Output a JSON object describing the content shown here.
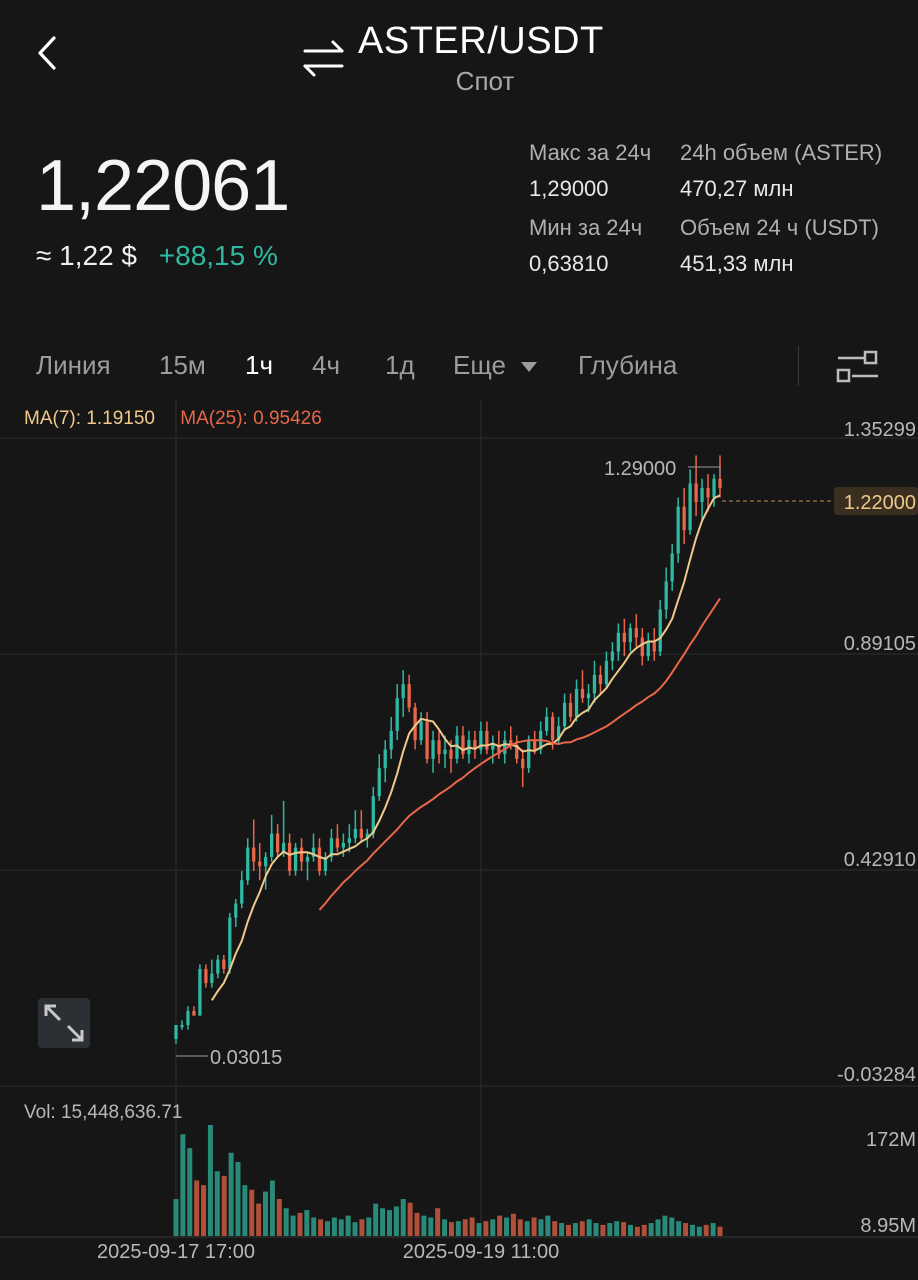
{
  "header": {
    "pair": "ASTER/USDT",
    "market": "Спот"
  },
  "price": {
    "last": "1,22061",
    "approx": "≈ 1,22 $",
    "change": "+88,15 %"
  },
  "stats": {
    "high_label": "Макс за 24ч",
    "high_value": "1,29000",
    "low_label": "Мин за 24ч",
    "low_value": "0,63810",
    "vol_base_label": "24h объем (ASTER)",
    "vol_base_value": "470,27 млн",
    "vol_quote_label": "Объем 24 ч (USDT)",
    "vol_quote_value": "451,33 млн"
  },
  "tabs": {
    "line": "Линия",
    "m15": "15м",
    "h1": "1ч",
    "h4": "4ч",
    "d1": "1д",
    "more": "Еще",
    "depth": "Глубина"
  },
  "indicators": {
    "ma7": "MA(7): 1.19150",
    "ma25": "MA(25): 0.95426"
  },
  "chart_data": {
    "type": "candlestick",
    "y_ticks": [
      "1.35299",
      "0.89105",
      "0.42910",
      "-0.03284"
    ],
    "ylim": [
      -0.03284,
      1.35299
    ],
    "x_ticks": [
      "2025-09-17 17:00",
      "2025-09-19 11:00"
    ],
    "high_label": "1.29000",
    "low_label": "0.03015",
    "current_label": "1.22000",
    "volume_label": "Vol: 15,448,636.71",
    "volume_ticks": [
      "172M",
      "8.95M"
    ],
    "colors": {
      "up": "#2fb8a2",
      "down": "#e8674a",
      "ma7": "#f0c98a",
      "ma25": "#e8674a"
    },
    "candles": [
      [
        0.04,
        0.07,
        0.03,
        0.07
      ],
      [
        0.07,
        0.08,
        0.06,
        0.07
      ],
      [
        0.07,
        0.11,
        0.06,
        0.1
      ],
      [
        0.1,
        0.11,
        0.09,
        0.09
      ],
      [
        0.09,
        0.2,
        0.09,
        0.19
      ],
      [
        0.19,
        0.2,
        0.15,
        0.16
      ],
      [
        0.16,
        0.21,
        0.15,
        0.18
      ],
      [
        0.18,
        0.22,
        0.17,
        0.21
      ],
      [
        0.21,
        0.22,
        0.18,
        0.19
      ],
      [
        0.19,
        0.31,
        0.18,
        0.3
      ],
      [
        0.3,
        0.34,
        0.28,
        0.33
      ],
      [
        0.33,
        0.4,
        0.32,
        0.38
      ],
      [
        0.38,
        0.47,
        0.37,
        0.45
      ],
      [
        0.45,
        0.51,
        0.4,
        0.42
      ],
      [
        0.42,
        0.46,
        0.38,
        0.41
      ],
      [
        0.41,
        0.44,
        0.36,
        0.43
      ],
      [
        0.43,
        0.52,
        0.42,
        0.48
      ],
      [
        0.48,
        0.5,
        0.43,
        0.44
      ],
      [
        0.44,
        0.55,
        0.43,
        0.46
      ],
      [
        0.46,
        0.48,
        0.39,
        0.4
      ],
      [
        0.4,
        0.46,
        0.39,
        0.45
      ],
      [
        0.45,
        0.47,
        0.4,
        0.42
      ],
      [
        0.42,
        0.44,
        0.38,
        0.43
      ],
      [
        0.43,
        0.48,
        0.42,
        0.45
      ],
      [
        0.45,
        0.47,
        0.39,
        0.4
      ],
      [
        0.4,
        0.44,
        0.39,
        0.43
      ],
      [
        0.43,
        0.49,
        0.42,
        0.47
      ],
      [
        0.47,
        0.5,
        0.44,
        0.45
      ],
      [
        0.45,
        0.48,
        0.43,
        0.46
      ],
      [
        0.46,
        0.5,
        0.44,
        0.47
      ],
      [
        0.47,
        0.53,
        0.46,
        0.49
      ],
      [
        0.49,
        0.53,
        0.46,
        0.47
      ],
      [
        0.47,
        0.49,
        0.45,
        0.48
      ],
      [
        0.48,
        0.58,
        0.47,
        0.56
      ],
      [
        0.56,
        0.65,
        0.55,
        0.62
      ],
      [
        0.62,
        0.68,
        0.59,
        0.66
      ],
      [
        0.66,
        0.73,
        0.64,
        0.7
      ],
      [
        0.7,
        0.8,
        0.68,
        0.77
      ],
      [
        0.77,
        0.83,
        0.73,
        0.8
      ],
      [
        0.8,
        0.82,
        0.74,
        0.75
      ],
      [
        0.75,
        0.76,
        0.66,
        0.68
      ],
      [
        0.68,
        0.74,
        0.67,
        0.72
      ],
      [
        0.72,
        0.74,
        0.63,
        0.64
      ],
      [
        0.64,
        0.7,
        0.61,
        0.68
      ],
      [
        0.68,
        0.7,
        0.63,
        0.65
      ],
      [
        0.65,
        0.69,
        0.62,
        0.66
      ],
      [
        0.66,
        0.68,
        0.61,
        0.64
      ],
      [
        0.64,
        0.71,
        0.63,
        0.69
      ],
      [
        0.69,
        0.71,
        0.64,
        0.65
      ],
      [
        0.65,
        0.7,
        0.63,
        0.68
      ],
      [
        0.68,
        0.7,
        0.64,
        0.66
      ],
      [
        0.66,
        0.72,
        0.65,
        0.7
      ],
      [
        0.7,
        0.72,
        0.65,
        0.66
      ],
      [
        0.66,
        0.69,
        0.63,
        0.67
      ],
      [
        0.67,
        0.7,
        0.64,
        0.65
      ],
      [
        0.65,
        0.7,
        0.63,
        0.68
      ],
      [
        0.68,
        0.71,
        0.66,
        0.67
      ],
      [
        0.67,
        0.69,
        0.63,
        0.64
      ],
      [
        0.64,
        0.66,
        0.58,
        0.62
      ],
      [
        0.62,
        0.69,
        0.61,
        0.68
      ],
      [
        0.68,
        0.7,
        0.65,
        0.66
      ],
      [
        0.66,
        0.72,
        0.65,
        0.7
      ],
      [
        0.7,
        0.75,
        0.69,
        0.73
      ],
      [
        0.73,
        0.74,
        0.66,
        0.68
      ],
      [
        0.68,
        0.73,
        0.67,
        0.71
      ],
      [
        0.71,
        0.78,
        0.7,
        0.76
      ],
      [
        0.76,
        0.78,
        0.72,
        0.73
      ],
      [
        0.73,
        0.81,
        0.72,
        0.79
      ],
      [
        0.79,
        0.83,
        0.76,
        0.77
      ],
      [
        0.77,
        0.8,
        0.74,
        0.78
      ],
      [
        0.78,
        0.85,
        0.76,
        0.82
      ],
      [
        0.82,
        0.84,
        0.78,
        0.8
      ],
      [
        0.8,
        0.87,
        0.79,
        0.85
      ],
      [
        0.85,
        0.89,
        0.83,
        0.87
      ],
      [
        0.87,
        0.93,
        0.85,
        0.91
      ],
      [
        0.91,
        0.94,
        0.86,
        0.89
      ],
      [
        0.89,
        0.93,
        0.87,
        0.92
      ],
      [
        0.92,
        0.95,
        0.88,
        0.9
      ],
      [
        0.9,
        0.92,
        0.84,
        0.86
      ],
      [
        0.86,
        0.91,
        0.85,
        0.89
      ],
      [
        0.89,
        0.92,
        0.85,
        0.87
      ],
      [
        0.87,
        0.98,
        0.86,
        0.96
      ],
      [
        0.96,
        1.05,
        0.94,
        1.02
      ],
      [
        1.02,
        1.1,
        1.0,
        1.08
      ],
      [
        1.08,
        1.2,
        1.06,
        1.18
      ],
      [
        1.18,
        1.22,
        1.1,
        1.13
      ],
      [
        1.13,
        1.26,
        1.12,
        1.23
      ],
      [
        1.23,
        1.29,
        1.16,
        1.19
      ],
      [
        1.19,
        1.24,
        1.15,
        1.22
      ],
      [
        1.22,
        1.25,
        1.17,
        1.2
      ],
      [
        1.2,
        1.25,
        1.18,
        1.24
      ],
      [
        1.24,
        1.29,
        1.2,
        1.22
      ]
    ],
    "volume": [
      40,
      110,
      95,
      60,
      55,
      120,
      70,
      65,
      90,
      80,
      55,
      50,
      35,
      48,
      60,
      40,
      30,
      22,
      25,
      28,
      20,
      18,
      16,
      20,
      18,
      22,
      15,
      18,
      20,
      35,
      30,
      28,
      32,
      40,
      36,
      25,
      22,
      20,
      30,
      18,
      15,
      16,
      18,
      20,
      14,
      16,
      18,
      22,
      20,
      24,
      18,
      16,
      20,
      18,
      22,
      16,
      14,
      12,
      14,
      16,
      18,
      14,
      12,
      14,
      16,
      15,
      12,
      10,
      12,
      14,
      18,
      22,
      20,
      16,
      14,
      12,
      10,
      12,
      14,
      10
    ]
  }
}
